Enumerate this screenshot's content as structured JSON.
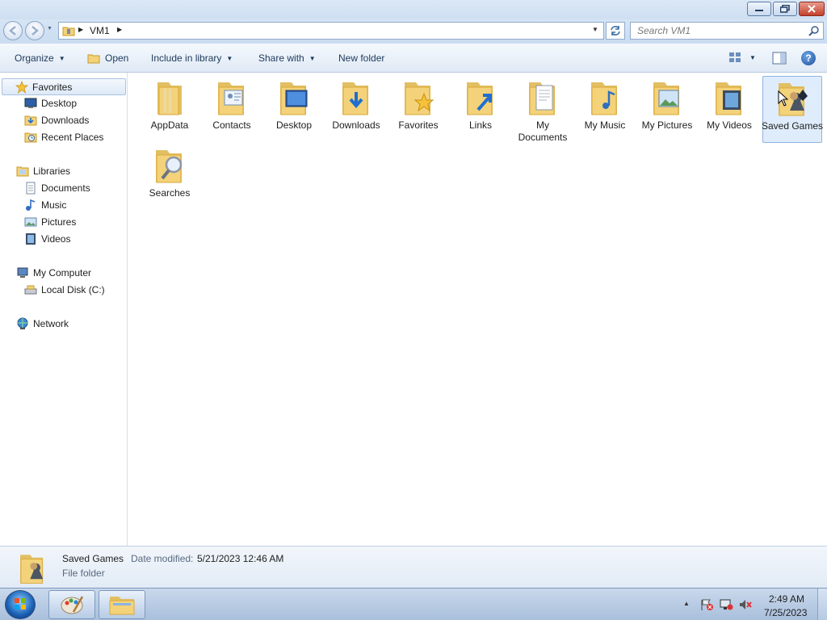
{
  "window": {
    "controls": {
      "minimize": "minimize",
      "maximize": "restore",
      "close": "close"
    }
  },
  "address": {
    "path": "VM1",
    "search_placeholder": "Search VM1"
  },
  "toolbar": {
    "organize": "Organize",
    "open": "Open",
    "include_in_library": "Include in library",
    "share_with": "Share with",
    "new_folder": "New folder"
  },
  "navigation": {
    "favorites": {
      "label": "Favorites",
      "items": [
        "Desktop",
        "Downloads",
        "Recent Places"
      ]
    },
    "libraries": {
      "label": "Libraries",
      "items": [
        "Documents",
        "Music",
        "Pictures",
        "Videos"
      ]
    },
    "computer": {
      "label": "My Computer",
      "items": [
        "Local Disk (C:)"
      ]
    },
    "network": {
      "label": "Network"
    }
  },
  "folders": [
    {
      "name": "AppData",
      "icon": "appdata-folder-icon"
    },
    {
      "name": "Contacts",
      "icon": "contacts-folder-icon"
    },
    {
      "name": "Desktop",
      "icon": "desktop-folder-icon"
    },
    {
      "name": "Downloads",
      "icon": "downloads-folder-icon"
    },
    {
      "name": "Favorites",
      "icon": "favorites-folder-icon"
    },
    {
      "name": "Links",
      "icon": "links-folder-icon"
    },
    {
      "name": "My Documents",
      "icon": "documents-folder-icon"
    },
    {
      "name": "My Music",
      "icon": "music-folder-icon"
    },
    {
      "name": "My Pictures",
      "icon": "pictures-folder-icon"
    },
    {
      "name": "My Videos",
      "icon": "videos-folder-icon"
    },
    {
      "name": "Saved Games",
      "icon": "saved-games-folder-icon",
      "selected": true
    },
    {
      "name": "Searches",
      "icon": "searches-folder-icon"
    }
  ],
  "details": {
    "name": "Saved Games",
    "date_label": "Date modified:",
    "date_value": "5/21/2023 12:46 AM",
    "type": "File folder"
  },
  "taskbar": {
    "clock_time": "2:49 AM",
    "clock_date": "7/25/2023",
    "pinned": [
      "paint-app-icon",
      "windows-explorer-icon"
    ]
  },
  "colors": {
    "folder": "#f3d27a",
    "folder_dark": "#d9a93c",
    "selection": "#dfecfb",
    "accent": "#1e395b"
  }
}
